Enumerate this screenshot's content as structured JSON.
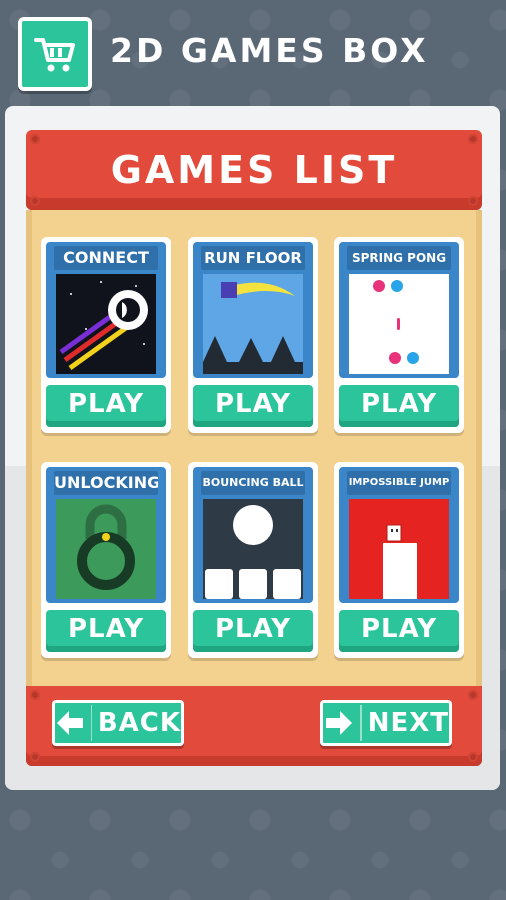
{
  "header": {
    "title": "2D GAMES BOX",
    "icon": "shopping-cart-icon"
  },
  "banner": {
    "title": "GAMES LIST"
  },
  "games": [
    {
      "title": "CONNECT",
      "play_label": "PLAY",
      "thumb": "connect-thumbnail"
    },
    {
      "title": "RUN FLOOR",
      "play_label": "PLAY",
      "thumb": "run-floor-thumbnail"
    },
    {
      "title": "SPRING PONG",
      "play_label": "PLAY",
      "thumb": "spring-pong-thumbnail"
    },
    {
      "title": "UNLOCKING",
      "play_label": "PLAY",
      "thumb": "unlocking-thumbnail"
    },
    {
      "title": "BOUNCING BALL",
      "play_label": "PLAY",
      "thumb": "bouncing-ball-thumbnail"
    },
    {
      "title": "IMPOSSIBLE JUMP",
      "play_label": "PLAY",
      "thumb": "impossible-jump-thumbnail"
    }
  ],
  "nav": {
    "back_label": "BACK",
    "next_label": "NEXT"
  },
  "colors": {
    "accent": "#2cc49a",
    "banner_red": "#e24a3b",
    "card_blue": "#3a86c8",
    "board": "#f3d290",
    "background": "#5a6775"
  }
}
